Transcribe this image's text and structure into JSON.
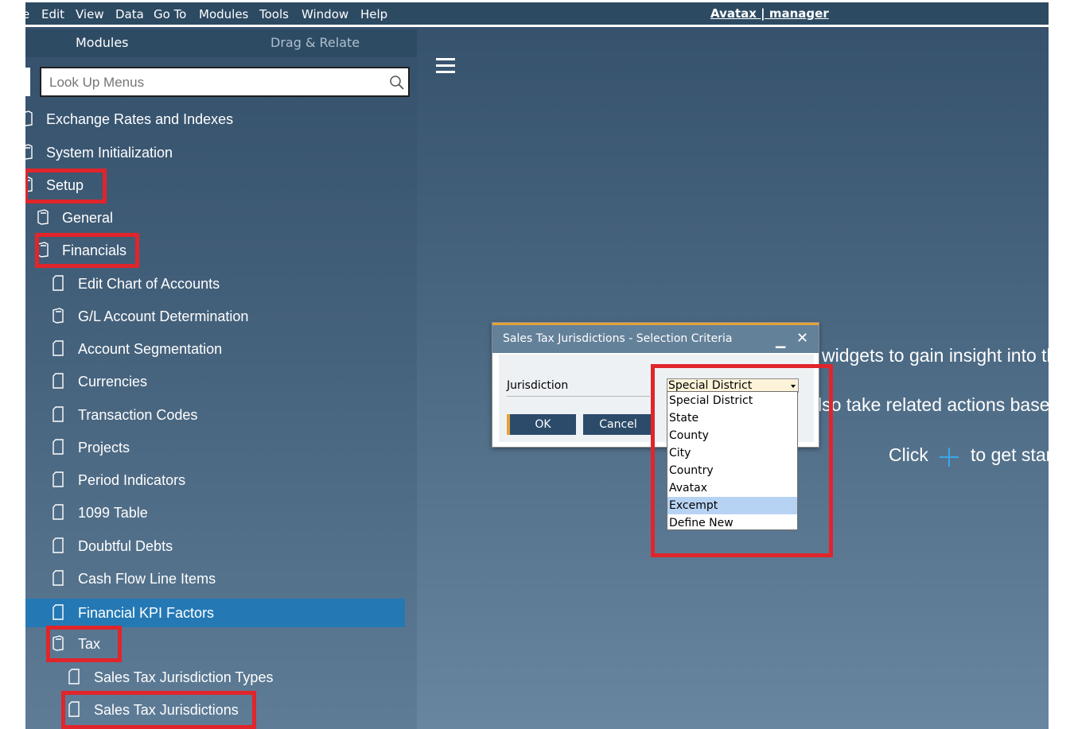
{
  "menubar": {
    "items": [
      "e",
      "Edit",
      "View",
      "Data",
      "Go To",
      "Modules",
      "Tools",
      "Window",
      "Help"
    ],
    "window_title": "Avatax | manager"
  },
  "sidebar": {
    "tabs": {
      "modules": "Modules",
      "drag_relate": "Drag & Relate"
    },
    "search": {
      "placeholder": "Look Up Menus"
    },
    "items": [
      {
        "label": "Exchange Rates and Indexes"
      },
      {
        "label": "System Initialization"
      },
      {
        "label": "Setup"
      },
      {
        "label": "General"
      },
      {
        "label": "Financials"
      },
      {
        "label": "Edit Chart of Accounts"
      },
      {
        "label": "G/L Account Determination"
      },
      {
        "label": "Account Segmentation"
      },
      {
        "label": "Currencies"
      },
      {
        "label": "Transaction Codes"
      },
      {
        "label": "Projects"
      },
      {
        "label": "Period Indicators"
      },
      {
        "label": "1099 Table"
      },
      {
        "label": "Doubtful Debts"
      },
      {
        "label": "Cash Flow Line Items"
      },
      {
        "label": "Financial KPI Factors"
      },
      {
        "label": "Tax"
      },
      {
        "label": "Sales Tax Jurisdiction Types"
      },
      {
        "label": "Sales Tax Jurisdictions"
      }
    ]
  },
  "main": {
    "line1": "widgets to gain insight into th",
    "line2": "lso take related actions based",
    "click_label": "Click",
    "get_started": "to get star"
  },
  "dialog": {
    "title": "Sales Tax Jurisdictions - Selection Criteria",
    "jurisdiction_label": "Jurisdiction",
    "selected_value": "Special District",
    "ok_label": "OK",
    "cancel_label": "Cancel",
    "options": [
      "Special District",
      "State",
      "County",
      "City",
      "Country",
      "Avatax",
      "Excempt",
      "Define New"
    ],
    "highlighted_option": "Excempt"
  },
  "colors": {
    "menubar": "#2d4a63",
    "selected_item": "#2479b5",
    "annotation_red": "#e0252b",
    "dialog_accent": "#e4a23a",
    "dropdown_highlight": "#b7d3f3"
  }
}
